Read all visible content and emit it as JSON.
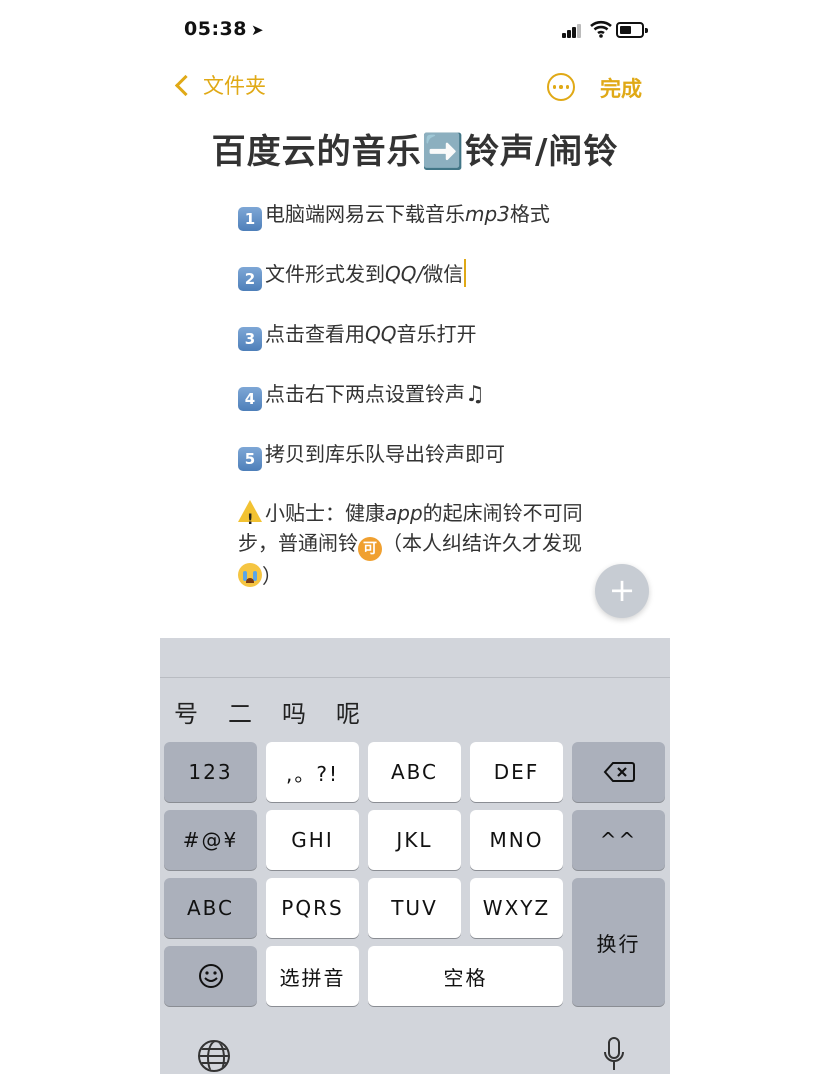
{
  "status": {
    "time": "05:38",
    "location_icon": "location-arrow-icon"
  },
  "nav": {
    "back_label": "文件夹",
    "done_label": "完成"
  },
  "note": {
    "title": "百度云的音乐➡️铃声/闹铃",
    "steps": [
      {
        "num": "1",
        "pre": "电脑端网易云下载音乐",
        "em": "mp3",
        "post": "格式"
      },
      {
        "num": "2",
        "pre": "文件形式发到",
        "em": "QQ/",
        "post": "微信"
      },
      {
        "num": "3",
        "pre": "点击查看用",
        "em": "QQ",
        "post": "音乐打开"
      },
      {
        "num": "4",
        "pre": "点击右下两点设置铃声",
        "em": "",
        "post": ""
      },
      {
        "num": "5",
        "pre": "拷贝到库乐队导出铃声即可",
        "em": "",
        "post": ""
      }
    ],
    "music_glyph": "♫",
    "tip": {
      "pre": "小贴士：健康",
      "em": "app",
      "mid": "的起床闹铃不可同步，普通闹铃",
      "ke": "可",
      "post": "（本人纠结许久才发现",
      "end": "）"
    }
  },
  "fab_label": "+",
  "keyboard": {
    "candidates": [
      "号",
      "二",
      "吗",
      "呢"
    ],
    "keys": {
      "num": "123",
      "punct": ",。?!",
      "abc": "ABC",
      "def": "DEF",
      "sym": "#@¥",
      "ghi": "GHI",
      "jkl": "JKL",
      "mno": "MNO",
      "caret": "^^",
      "abc_mode": "ABC",
      "pqrs": "PQRS",
      "tuv": "TUV",
      "wxyz": "WXYZ",
      "newline": "换行",
      "pinyin": "选拼音",
      "space": "空格"
    }
  }
}
